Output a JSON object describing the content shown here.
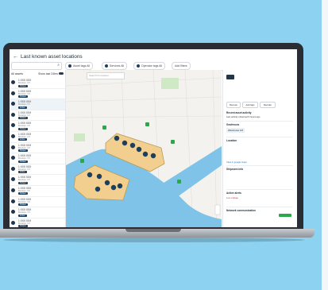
{
  "page": {
    "title": "Last known asset locations"
  },
  "filters": {
    "search_placeholder": "",
    "chips": [
      "Asset tags All",
      "Services All",
      "Operator tags All",
      "Add filters"
    ]
  },
  "sidebar": {
    "header": "All assets",
    "show_label": "Show last 24hrs",
    "assets": [
      {
        "name": "1 XXX XXX",
        "addr": "Brooklyn, NY",
        "tag": "Parked"
      },
      {
        "name": "1 XXX XXX",
        "addr": "Brooklyn, NY",
        "tag": "Parked"
      },
      {
        "name": "1 XXX XXX",
        "addr": "Brooklyn, NY",
        "tag": "Active"
      },
      {
        "name": "1 XXX XXX",
        "addr": "Brooklyn, NY",
        "tag": "Parked"
      },
      {
        "name": "1 XXX XXX",
        "addr": "Brooklyn, NY",
        "tag": "Parked"
      },
      {
        "name": "1 XXX XXX",
        "addr": "Brooklyn, NY",
        "tag": "Active"
      },
      {
        "name": "1 XXX XXX",
        "addr": "Brooklyn, NY",
        "tag": "Parked"
      },
      {
        "name": "1 XXX XXX",
        "addr": "Brooklyn, NY",
        "tag": "Parked"
      },
      {
        "name": "1 XXX XXX",
        "addr": "Brooklyn, NY",
        "tag": "Active"
      },
      {
        "name": "1 XXX XXX",
        "addr": "Brooklyn, NY",
        "tag": "Parked"
      },
      {
        "name": "1 XXX XXX",
        "addr": "Brooklyn, NY",
        "tag": "Parked"
      },
      {
        "name": "1 XXX XXX",
        "addr": "Brooklyn, NY",
        "tag": "Parked"
      },
      {
        "name": "1 XXX XXX",
        "addr": "Brooklyn, NY",
        "tag": "Active"
      },
      {
        "name": "1 XXX XXX",
        "addr": "Brooklyn, NY",
        "tag": "Parked"
      },
      {
        "name": "1 XXX XXX",
        "addr": "Brooklyn, NY",
        "tag": "Parked"
      }
    ]
  },
  "map": {
    "search_placeholder": "Search for location"
  },
  "detail": {
    "asset_id": "1 DVD 569",
    "buttons": [
      "Reroute",
      "Add tags",
      "Reorder"
    ],
    "section_activity": "Recent asset activity",
    "activity_text": "Last activity observed 6 hours ago",
    "section_geofences": "Geofences",
    "geofence_name": "Warehouse 1/8",
    "section_location": "Location",
    "section_shipment": "Shipment info",
    "section_alerts": "Active alerts",
    "alert_text": "Low voltage",
    "section_network": "Network communication",
    "link_text": "View in google maps"
  },
  "colors": {
    "backdrop": "#8dd2f0",
    "water": "#7fc3e8",
    "zone": "#f2cf8f",
    "marker": "#1d3f5e",
    "accent": "#2aa84a"
  }
}
